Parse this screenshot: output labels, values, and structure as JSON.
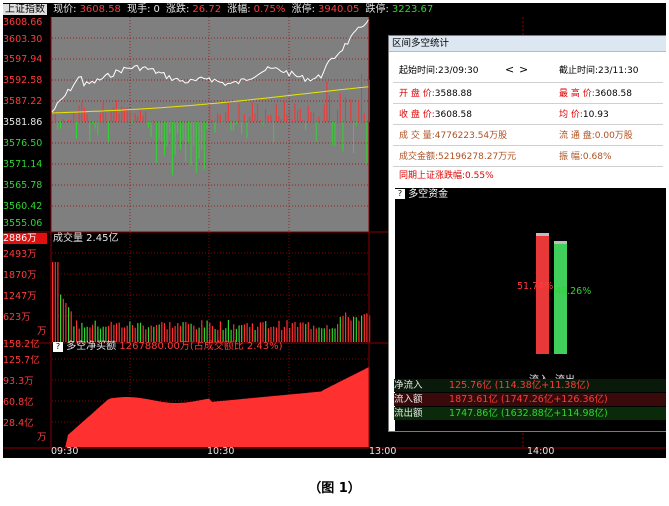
{
  "topbar": {
    "index_name": "上证指数",
    "price_label": "现价:",
    "price": "3608.58",
    "volume_label": "现手:",
    "volume": "0",
    "change_label": "涨跌:",
    "change": "26.72",
    "pct_label": "涨幅:",
    "pct": "0.75%",
    "limit_up_label": "涨停:",
    "limit_up": "3940.05",
    "limit_down_label": "跌停:",
    "limit_down": "3223.67"
  },
  "price_axis": [
    "3608.66",
    "3603.30",
    "3597.94",
    "3592.58",
    "3587.22",
    "3581.86",
    "3576.50",
    "3571.14",
    "3565.78",
    "3560.42",
    "3555.06"
  ],
  "volume_panel": {
    "title": "成交量 2.45亿",
    "axis": [
      "2886万",
      "2493万",
      "1870万",
      "1247万",
      "623万",
      "万"
    ]
  },
  "net_panel": {
    "title": "多空净买额",
    "value": "1267880.00万(占成交额比 2.43%)",
    "axis": [
      "158.2亿",
      "125.7亿",
      "93.3万",
      "60.8亿",
      "28.4亿",
      "万"
    ]
  },
  "time_axis": [
    "09:30",
    "10:30",
    "13:00",
    "14:00"
  ],
  "popup": {
    "title": "区间多空统计",
    "start_label": "起始时间:",
    "start_value": "23/09:30",
    "nav_prev": "<",
    "nav_next": ">",
    "end_label": "截止时间:",
    "end_value": "23/11:30",
    "open_label": "开 盘 价:",
    "open_value": "3588.88",
    "high_label": "最 高 价:",
    "high_value": "3608.58",
    "close_label": "收 盘 价:",
    "close_value": "3608.58",
    "avg_label": "均   价:",
    "avg_value": "10.93",
    "vol_label": "成 交 量:",
    "vol_value": "4776223.54万股",
    "float_label": "流 通 盘:",
    "float_value": "0.00万股",
    "amount_label": "成交金额:",
    "amount_value": "52196278.27万元",
    "amp_label": "振    幅:",
    "amp_value": "0.68%",
    "sync_text": "同期上证涨跌幅:0.55%"
  },
  "duokong": {
    "title": "多空资金",
    "bar_in_pct": "51.74%",
    "bar_out_pct": "48.26%",
    "bar_in_label": "流入",
    "bar_out_label": "流出",
    "rows": [
      {
        "label": "净流入",
        "value": "125.76亿 (114.38亿+11.38亿)"
      },
      {
        "label": "流入额",
        "value": "1873.61亿 (1747.26亿+126.36亿)"
      },
      {
        "label": "流出额",
        "value": "1747.86亿 (1632.88亿+114.98亿)"
      }
    ]
  },
  "caption": "（图 1）",
  "colors": {
    "up": "#ff3b3b",
    "down": "#2fd52f",
    "price_line": "#ffffff",
    "avg_line": "#e8e800",
    "grid": "#8b0000"
  }
}
